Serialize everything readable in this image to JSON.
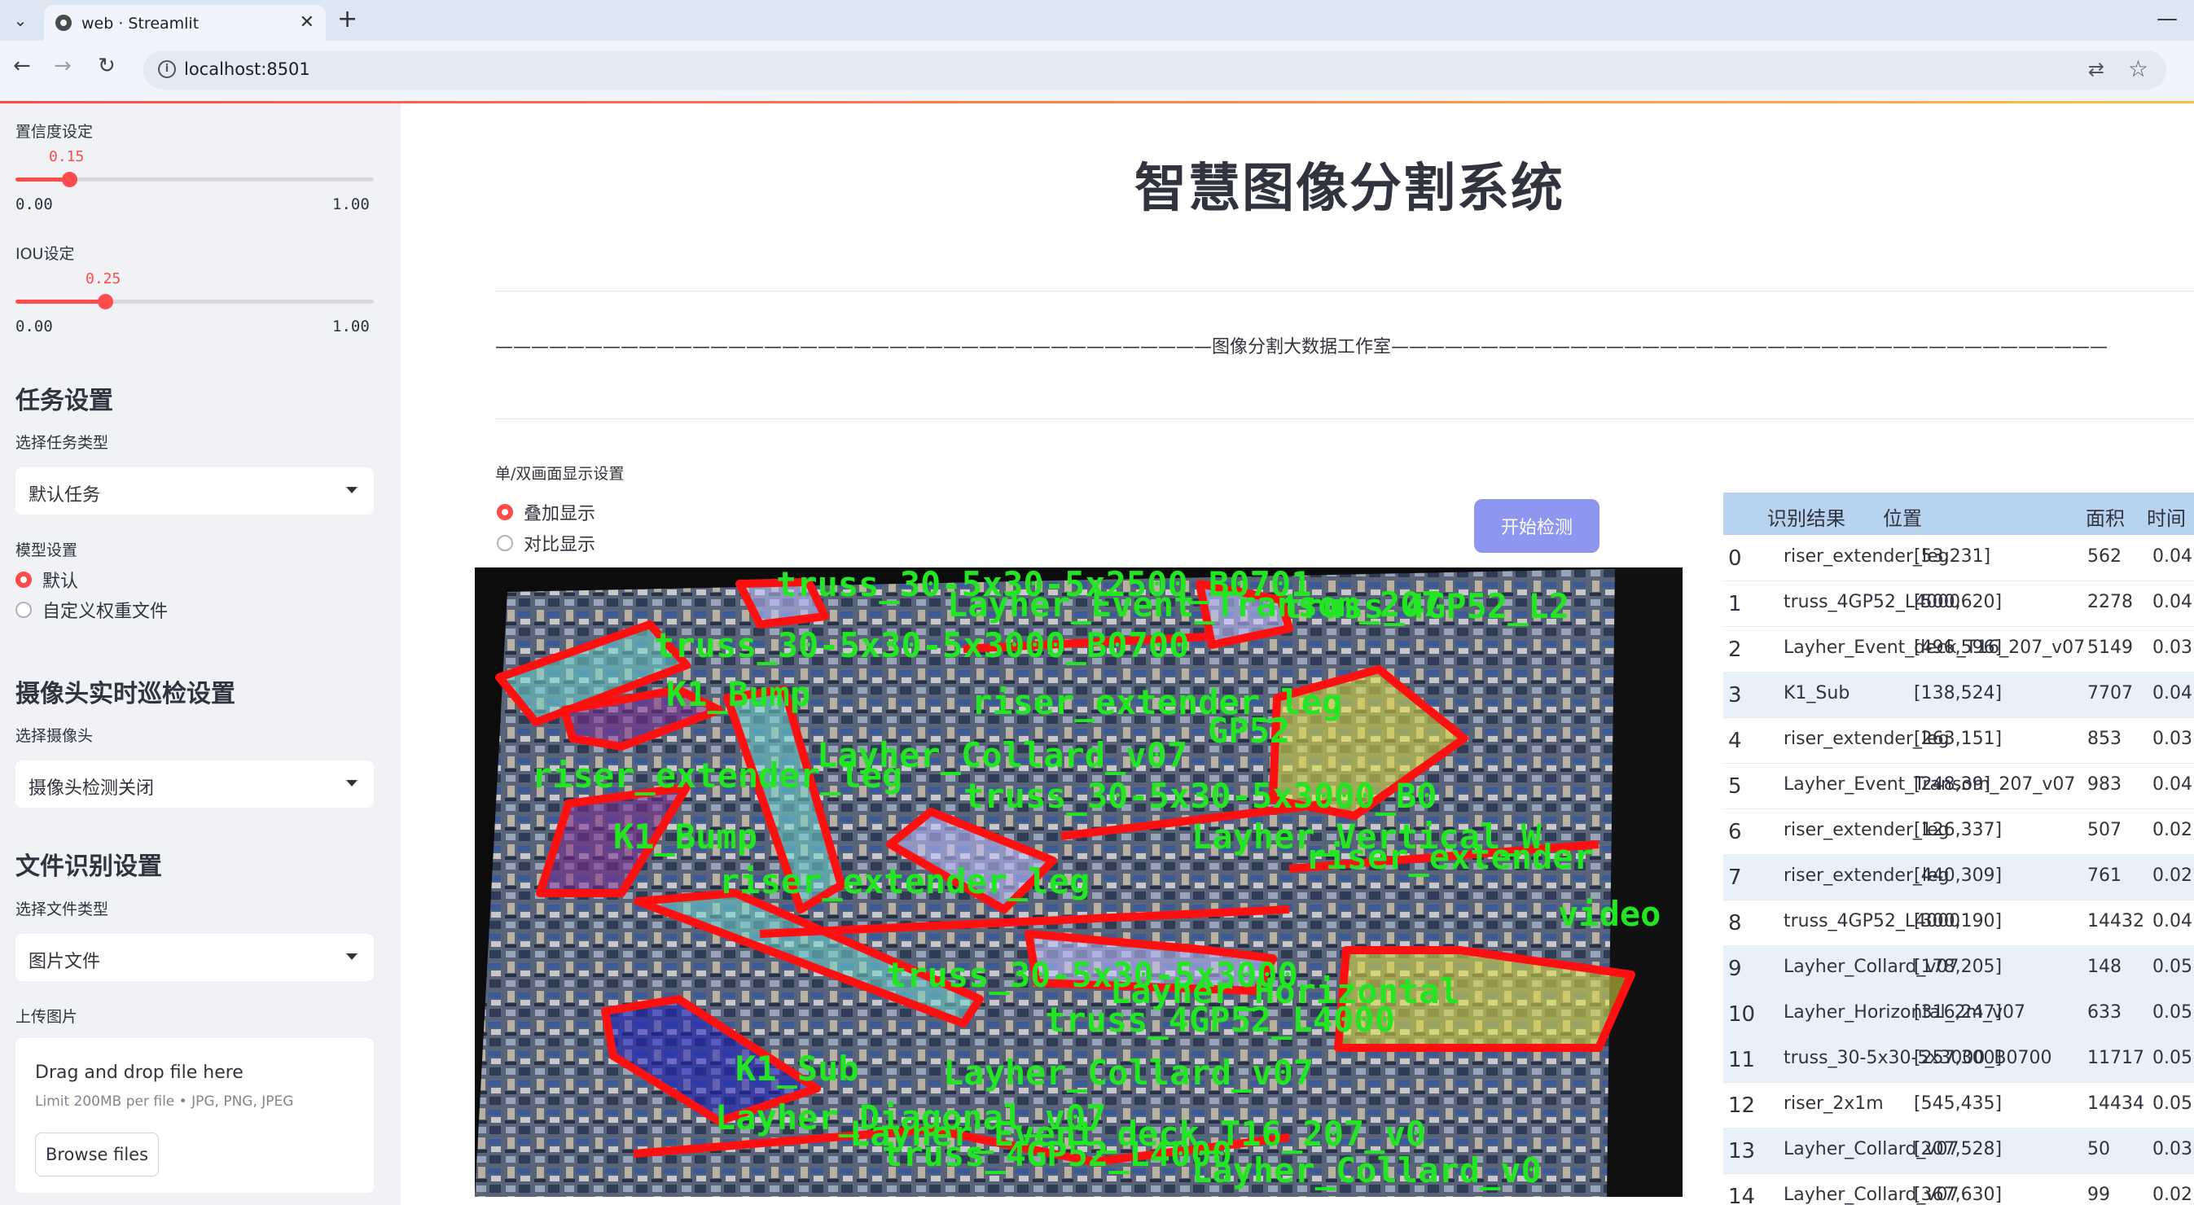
{
  "browser": {
    "tab_title": "web · Streamlit",
    "url": "localhost:8501"
  },
  "sidebar": {
    "confidence_label": "置信度设定",
    "confidence_value": "0.15",
    "confidence_fraction": 0.15,
    "iou_label": "IOU设定",
    "iou_value": "0.25",
    "iou_fraction": 0.25,
    "slider_min": "0.00",
    "slider_max": "1.00",
    "task_header": "任务设置",
    "task_type_label": "选择任务类型",
    "task_type_value": "默认任务",
    "model_label": "模型设置",
    "model_options": [
      "默认",
      "自定义权重文件"
    ],
    "model_selected": "默认",
    "camera_header": "摄像头实时巡检设置",
    "camera_label": "选择摄像头",
    "camera_value": "摄像头检测关闭",
    "file_header": "文件识别设置",
    "file_type_label": "选择文件类型",
    "file_type_value": "图片文件",
    "upload_label": "上传图片",
    "upload_drop": "Drag and drop file here",
    "upload_limit": "Limit 200MB per file • JPG, PNG, JPEG",
    "upload_browse": "Browse files"
  },
  "main": {
    "title": "智慧图像分割系统",
    "studio_line": "————————————————————————————————————————图像分割大数据工作室————————————————————————————————————————",
    "display_mode_label": "单/双画面显示设置",
    "display_options": [
      "叠加显示",
      "对比显示"
    ],
    "display_selected": "叠加显示",
    "start_button": "开始检测"
  },
  "detection_overlay_labels": [
    "truss_30-5x30-5x2500_B0701",
    "Layher_Event_Transom_207",
    "truss_4GP52_L2",
    "truss_30-5x30-5x3000_B0700",
    "K1_Bump",
    "riser_extender_leg",
    "GP52",
    "Layher_Collard_v07",
    "riser_extender_leg",
    "truss_30-5x30-5x3000_B0",
    "K1_Bump",
    "Layher_Vertical_W",
    "riser_extender",
    "riser_extender_leg",
    "video",
    "truss_30-5x30-5x3000",
    "Layher_Horizontal",
    "truss_4GP52_L4000",
    "K1_Sub",
    "Layher_Collard_v07",
    "Layher_Diagonal_v07",
    "Layher_Event_deck_T16_207_v0",
    "truss_4GP52_L4000",
    "Layher_Collard_v0"
  ],
  "results_table": {
    "headers": [
      "识别结果",
      "位置",
      "面积",
      "时间"
    ],
    "rows": [
      {
        "i": "0",
        "name": "riser_extender_leg",
        "pos": "[53,231]",
        "area": "562",
        "time": "0.04"
      },
      {
        "i": "1",
        "name": "truss_4GP52_L4000",
        "pos": "[500,620]",
        "area": "2278",
        "time": "0.04"
      },
      {
        "i": "2",
        "name": "Layher_Event_deck_T16_207_v07",
        "pos": "[496,596]",
        "area": "5149",
        "time": "0.03"
      },
      {
        "i": "3",
        "name": "K1_Sub",
        "pos": "[138,524]",
        "area": "7707",
        "time": "0.04"
      },
      {
        "i": "4",
        "name": "riser_extender_leg",
        "pos": "[263,151]",
        "area": "853",
        "time": "0.03"
      },
      {
        "i": "5",
        "name": "Layher_Event_Transom_207_v07",
        "pos": "[248,39]",
        "area": "983",
        "time": "0.04"
      },
      {
        "i": "6",
        "name": "riser_extender_leg",
        "pos": "[126,337]",
        "area": "507",
        "time": "0.02"
      },
      {
        "i": "7",
        "name": "riser_extender_leg",
        "pos": "[440,309]",
        "area": "761",
        "time": "0.02"
      },
      {
        "i": "8",
        "name": "truss_4GP52_L4000",
        "pos": "[300,190]",
        "area": "14432",
        "time": "0.04"
      },
      {
        "i": "9",
        "name": "Layher_Collard_v07",
        "pos": "[178,205]",
        "area": "148",
        "time": "0.05"
      },
      {
        "i": "10",
        "name": "Layher_Horizontal_2m_v07",
        "pos": "[316,247]",
        "area": "633",
        "time": "0.05"
      },
      {
        "i": "11",
        "name": "truss_30-5x30-5x3000_B0700",
        "pos": "[257,300]",
        "area": "11717",
        "time": "0.05"
      },
      {
        "i": "12",
        "name": "riser_2x1m",
        "pos": "[545,435]",
        "area": "14434",
        "time": "0.05"
      },
      {
        "i": "13",
        "name": "Layher_Collard_v07",
        "pos": "[207,528]",
        "area": "50",
        "time": "0.03"
      },
      {
        "i": "14",
        "name": "Layher_Collard_v07",
        "pos": "[367,630]",
        "area": "99",
        "time": "0.02"
      }
    ]
  },
  "colors": {
    "accent": "#ff4b4b",
    "sidebar_bg": "#f0f2f6",
    "button": "#8e97f0",
    "table_header": "#b7d3f0",
    "mask_outline": "#ff1010",
    "mask_label": "#22e622"
  }
}
